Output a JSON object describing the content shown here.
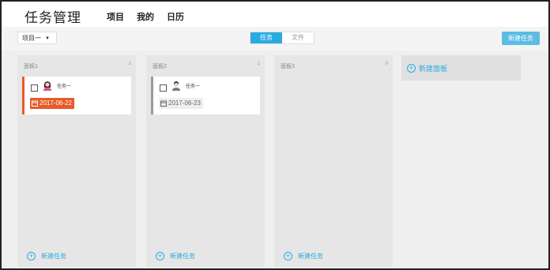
{
  "app": {
    "title": "任务管理"
  },
  "nav": [
    {
      "label": "项目"
    },
    {
      "label": "我的"
    },
    {
      "label": "日历"
    }
  ],
  "toolbar": {
    "project_select": "项目一",
    "view_toggle": [
      {
        "label": "任务",
        "active": true
      },
      {
        "label": "文件",
        "active": false
      }
    ],
    "new_task_button": "新建任务"
  },
  "columns": [
    {
      "title": "面板1",
      "count": "1",
      "new_task_link": "新建任务",
      "cards": [
        {
          "assignee": "任务一",
          "date": "2017-06-22",
          "status": "overdue",
          "avatar": "female-avatar-icon"
        }
      ]
    },
    {
      "title": "面板2",
      "count": "1",
      "new_task_link": "新建任务",
      "cards": [
        {
          "assignee": "任务一",
          "date": "2017-06-23",
          "status": "normal",
          "avatar": "male-avatar-icon"
        }
      ]
    },
    {
      "title": "面板3",
      "count": "0",
      "new_task_link": "新建任务",
      "cards": []
    }
  ],
  "new_board": {
    "label": "新建面板"
  },
  "colors": {
    "accent": "#29abe2",
    "overdue": "#e85a2a",
    "column_bg": "#e6e6e6",
    "page_bg": "#efefef"
  }
}
